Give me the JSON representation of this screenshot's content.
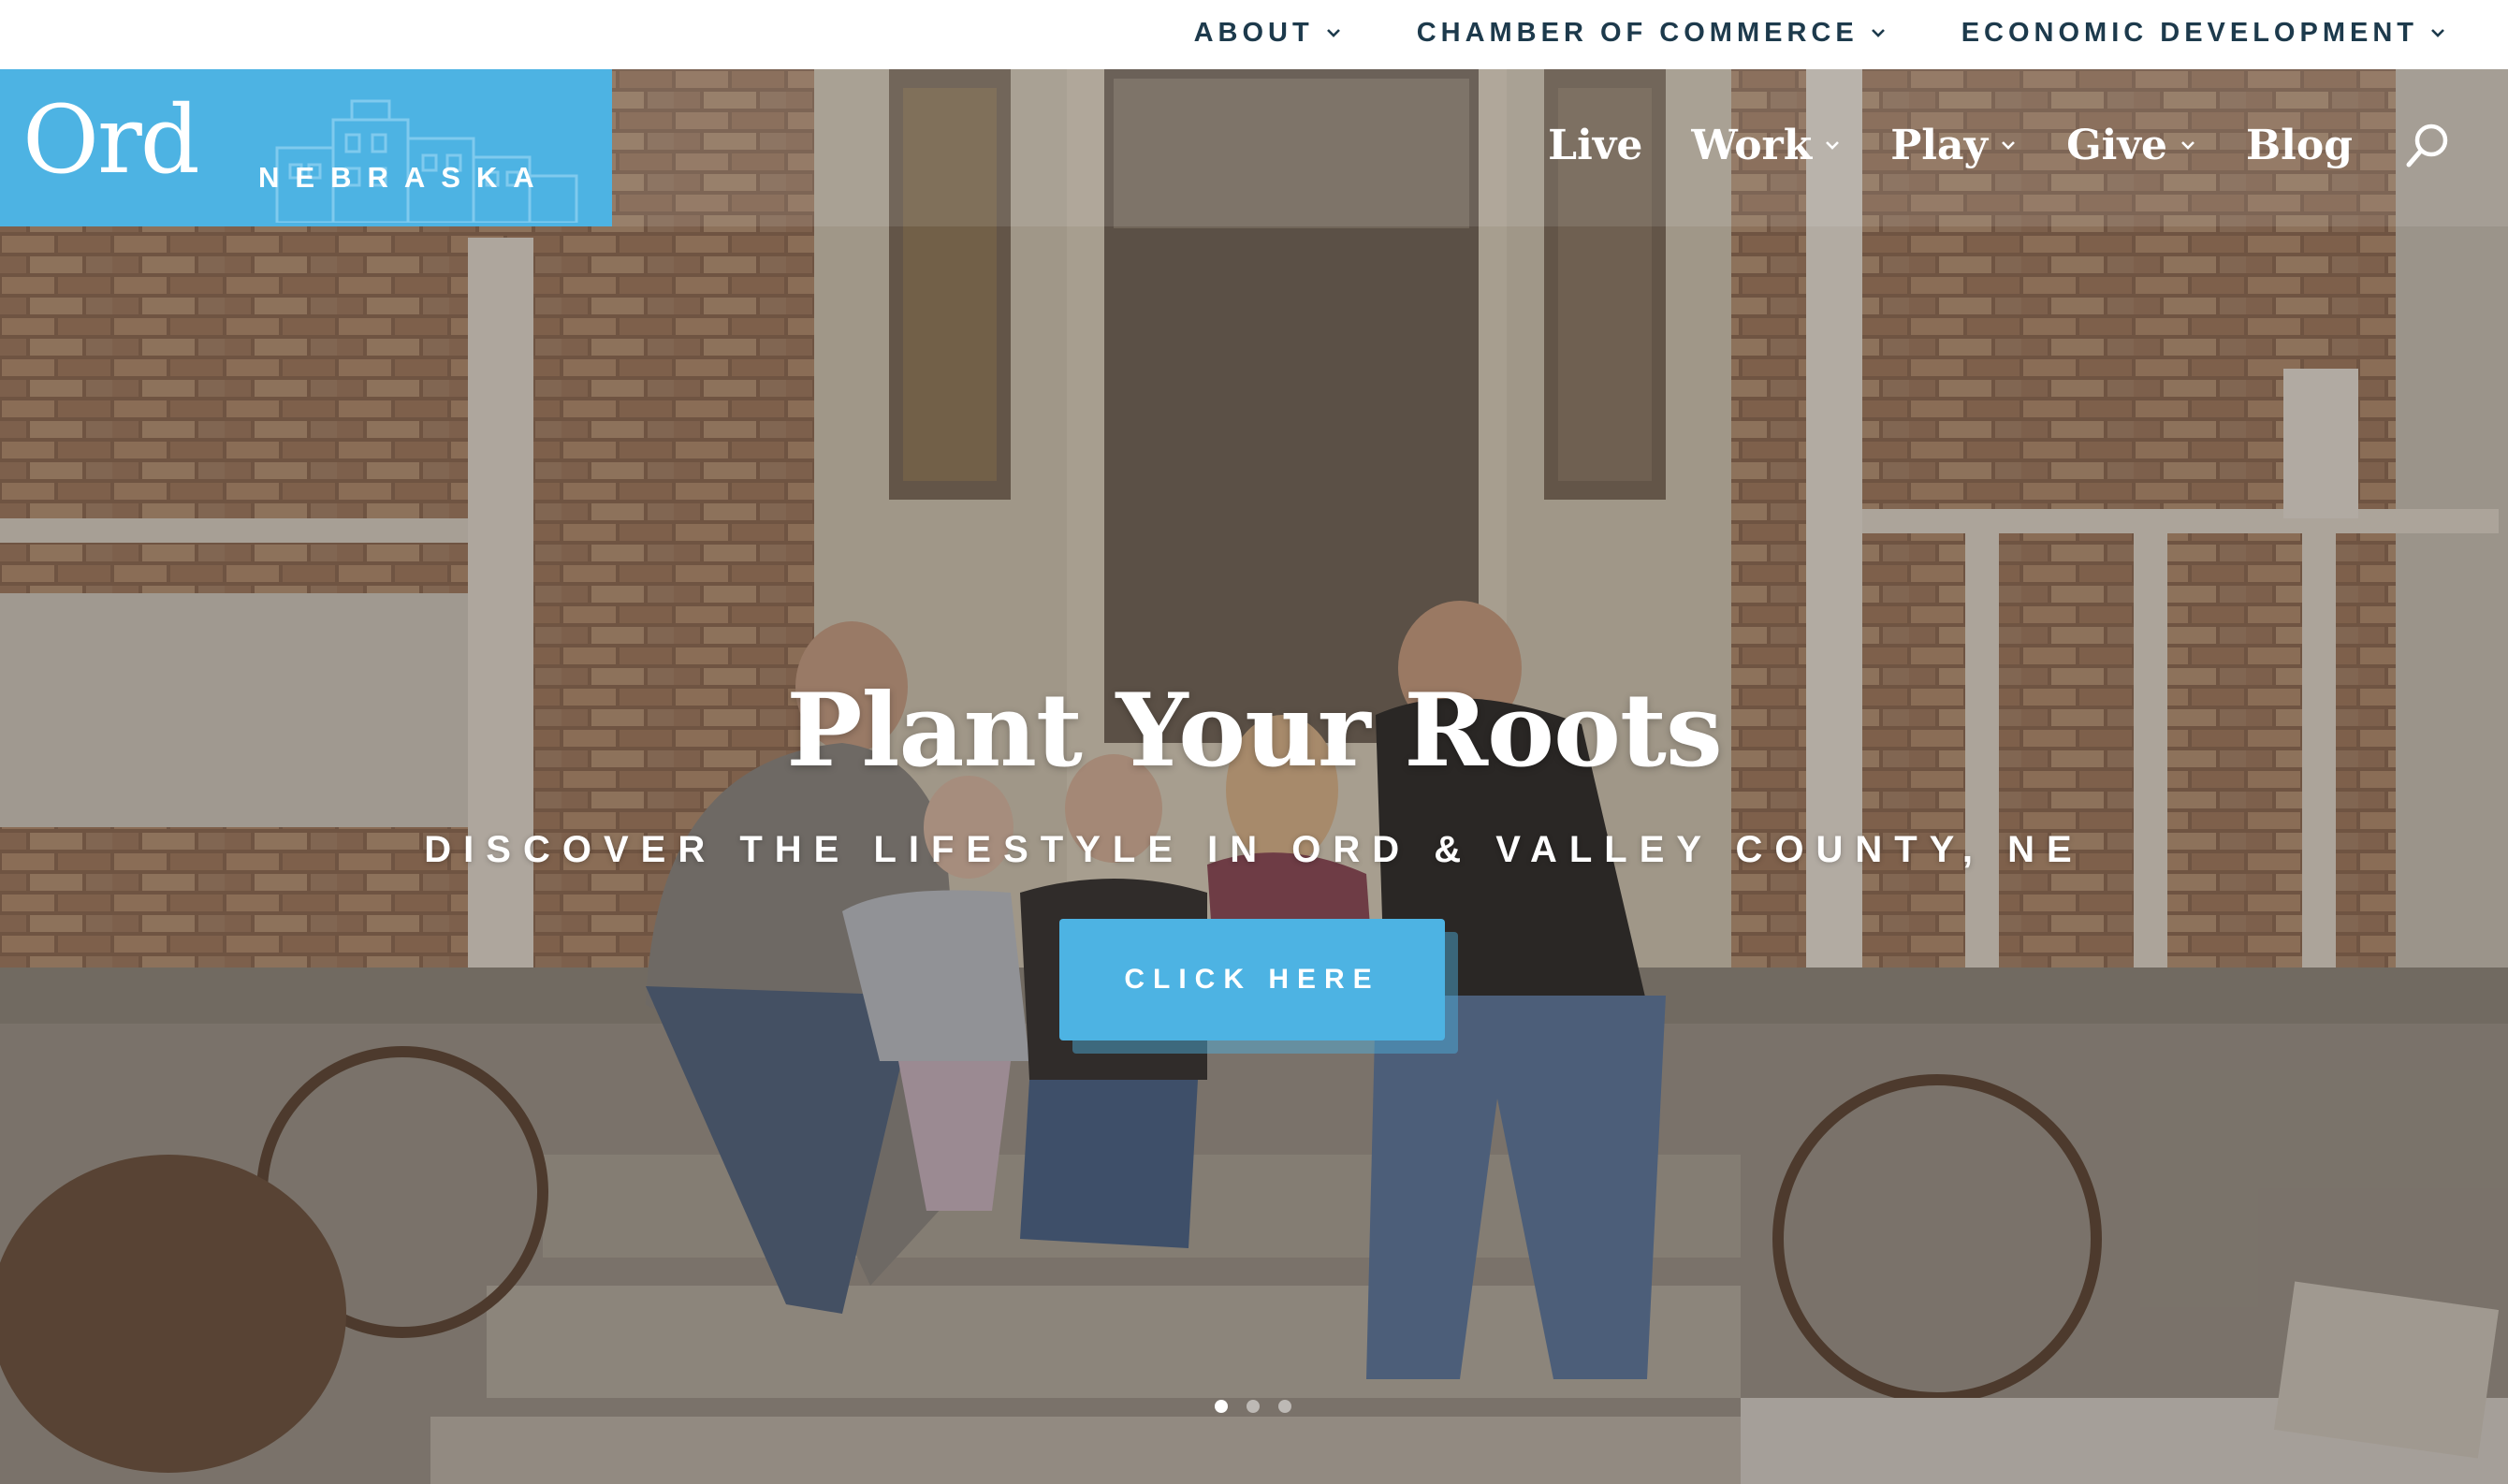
{
  "topnav": {
    "items": [
      {
        "label": "ABOUT"
      },
      {
        "label": "CHAMBER OF COMMERCE"
      },
      {
        "label": "ECONOMIC DEVELOPMENT"
      }
    ]
  },
  "logo": {
    "name": "Ord",
    "state": "NEBRASKA"
  },
  "mainnav": {
    "items": [
      {
        "label": "Live",
        "has_dropdown": false
      },
      {
        "label": "Work",
        "has_dropdown": true
      },
      {
        "label": "Play",
        "has_dropdown": true
      },
      {
        "label": "Give",
        "has_dropdown": true
      },
      {
        "label": "Blog",
        "has_dropdown": false
      }
    ],
    "search_icon": "search-icon"
  },
  "hero": {
    "title": "Plant Your Roots",
    "subtitle": "DISCOVER THE LIFESTYLE IN ORD & VALLEY COUNTY, NE",
    "cta_label": "CLICK HERE",
    "slides": 3,
    "active_slide": 1
  },
  "colors": {
    "brand_blue": "#4db3e3",
    "nav_text_dark": "#1d3a4c",
    "white": "#ffffff"
  }
}
